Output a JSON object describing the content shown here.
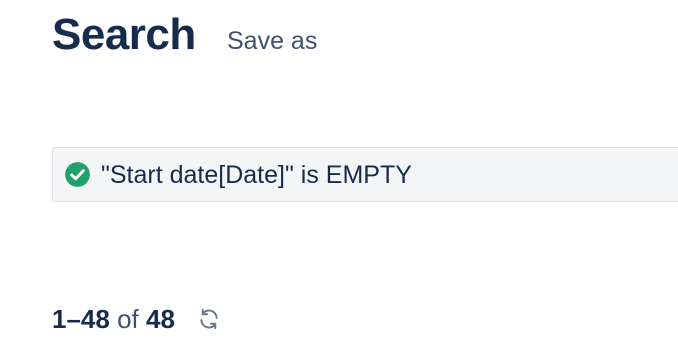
{
  "header": {
    "title": "Search",
    "save_as_label": "Save as"
  },
  "query": {
    "status_icon": "check-circle-icon",
    "status_color": "#22a06b",
    "text": "\"Start date[Date]\" is EMPTY"
  },
  "results": {
    "range": "1–48",
    "of_label": "of",
    "total": "48",
    "refresh_icon": "refresh-icon"
  }
}
